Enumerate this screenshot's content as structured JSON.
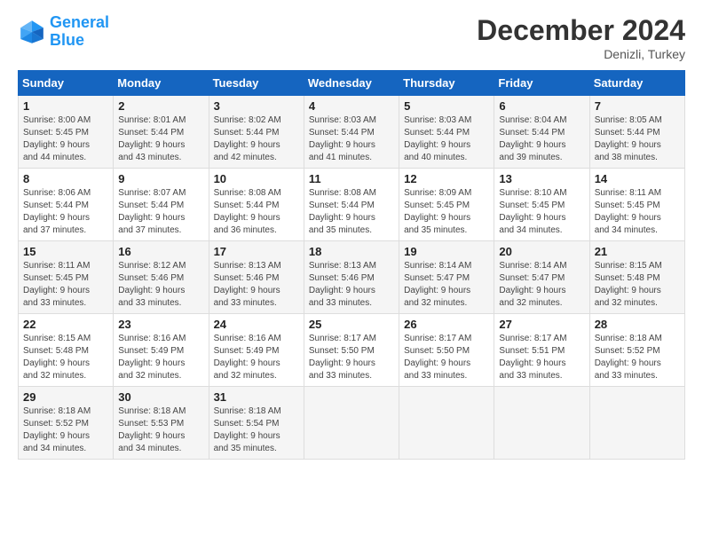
{
  "logo": {
    "line1": "General",
    "line2": "Blue"
  },
  "title": "December 2024",
  "location": "Denizli, Turkey",
  "days_of_week": [
    "Sunday",
    "Monday",
    "Tuesday",
    "Wednesday",
    "Thursday",
    "Friday",
    "Saturday"
  ],
  "weeks": [
    [
      {
        "day": "1",
        "sunrise": "8:00 AM",
        "sunset": "5:45 PM",
        "daylight": "9 hours and 44 minutes."
      },
      {
        "day": "2",
        "sunrise": "8:01 AM",
        "sunset": "5:44 PM",
        "daylight": "9 hours and 43 minutes."
      },
      {
        "day": "3",
        "sunrise": "8:02 AM",
        "sunset": "5:44 PM",
        "daylight": "9 hours and 42 minutes."
      },
      {
        "day": "4",
        "sunrise": "8:03 AM",
        "sunset": "5:44 PM",
        "daylight": "9 hours and 41 minutes."
      },
      {
        "day": "5",
        "sunrise": "8:03 AM",
        "sunset": "5:44 PM",
        "daylight": "9 hours and 40 minutes."
      },
      {
        "day": "6",
        "sunrise": "8:04 AM",
        "sunset": "5:44 PM",
        "daylight": "9 hours and 39 minutes."
      },
      {
        "day": "7",
        "sunrise": "8:05 AM",
        "sunset": "5:44 PM",
        "daylight": "9 hours and 38 minutes."
      }
    ],
    [
      {
        "day": "8",
        "sunrise": "8:06 AM",
        "sunset": "5:44 PM",
        "daylight": "9 hours and 37 minutes."
      },
      {
        "day": "9",
        "sunrise": "8:07 AM",
        "sunset": "5:44 PM",
        "daylight": "9 hours and 37 minutes."
      },
      {
        "day": "10",
        "sunrise": "8:08 AM",
        "sunset": "5:44 PM",
        "daylight": "9 hours and 36 minutes."
      },
      {
        "day": "11",
        "sunrise": "8:08 AM",
        "sunset": "5:44 PM",
        "daylight": "9 hours and 35 minutes."
      },
      {
        "day": "12",
        "sunrise": "8:09 AM",
        "sunset": "5:45 PM",
        "daylight": "9 hours and 35 minutes."
      },
      {
        "day": "13",
        "sunrise": "8:10 AM",
        "sunset": "5:45 PM",
        "daylight": "9 hours and 34 minutes."
      },
      {
        "day": "14",
        "sunrise": "8:11 AM",
        "sunset": "5:45 PM",
        "daylight": "9 hours and 34 minutes."
      }
    ],
    [
      {
        "day": "15",
        "sunrise": "8:11 AM",
        "sunset": "5:45 PM",
        "daylight": "9 hours and 33 minutes."
      },
      {
        "day": "16",
        "sunrise": "8:12 AM",
        "sunset": "5:46 PM",
        "daylight": "9 hours and 33 minutes."
      },
      {
        "day": "17",
        "sunrise": "8:13 AM",
        "sunset": "5:46 PM",
        "daylight": "9 hours and 33 minutes."
      },
      {
        "day": "18",
        "sunrise": "8:13 AM",
        "sunset": "5:46 PM",
        "daylight": "9 hours and 33 minutes."
      },
      {
        "day": "19",
        "sunrise": "8:14 AM",
        "sunset": "5:47 PM",
        "daylight": "9 hours and 32 minutes."
      },
      {
        "day": "20",
        "sunrise": "8:14 AM",
        "sunset": "5:47 PM",
        "daylight": "9 hours and 32 minutes."
      },
      {
        "day": "21",
        "sunrise": "8:15 AM",
        "sunset": "5:48 PM",
        "daylight": "9 hours and 32 minutes."
      }
    ],
    [
      {
        "day": "22",
        "sunrise": "8:15 AM",
        "sunset": "5:48 PM",
        "daylight": "9 hours and 32 minutes."
      },
      {
        "day": "23",
        "sunrise": "8:16 AM",
        "sunset": "5:49 PM",
        "daylight": "9 hours and 32 minutes."
      },
      {
        "day": "24",
        "sunrise": "8:16 AM",
        "sunset": "5:49 PM",
        "daylight": "9 hours and 32 minutes."
      },
      {
        "day": "25",
        "sunrise": "8:17 AM",
        "sunset": "5:50 PM",
        "daylight": "9 hours and 33 minutes."
      },
      {
        "day": "26",
        "sunrise": "8:17 AM",
        "sunset": "5:50 PM",
        "daylight": "9 hours and 33 minutes."
      },
      {
        "day": "27",
        "sunrise": "8:17 AM",
        "sunset": "5:51 PM",
        "daylight": "9 hours and 33 minutes."
      },
      {
        "day": "28",
        "sunrise": "8:18 AM",
        "sunset": "5:52 PM",
        "daylight": "9 hours and 33 minutes."
      }
    ],
    [
      {
        "day": "29",
        "sunrise": "8:18 AM",
        "sunset": "5:52 PM",
        "daylight": "9 hours and 34 minutes."
      },
      {
        "day": "30",
        "sunrise": "8:18 AM",
        "sunset": "5:53 PM",
        "daylight": "9 hours and 34 minutes."
      },
      {
        "day": "31",
        "sunrise": "8:18 AM",
        "sunset": "5:54 PM",
        "daylight": "9 hours and 35 minutes."
      },
      null,
      null,
      null,
      null
    ]
  ]
}
